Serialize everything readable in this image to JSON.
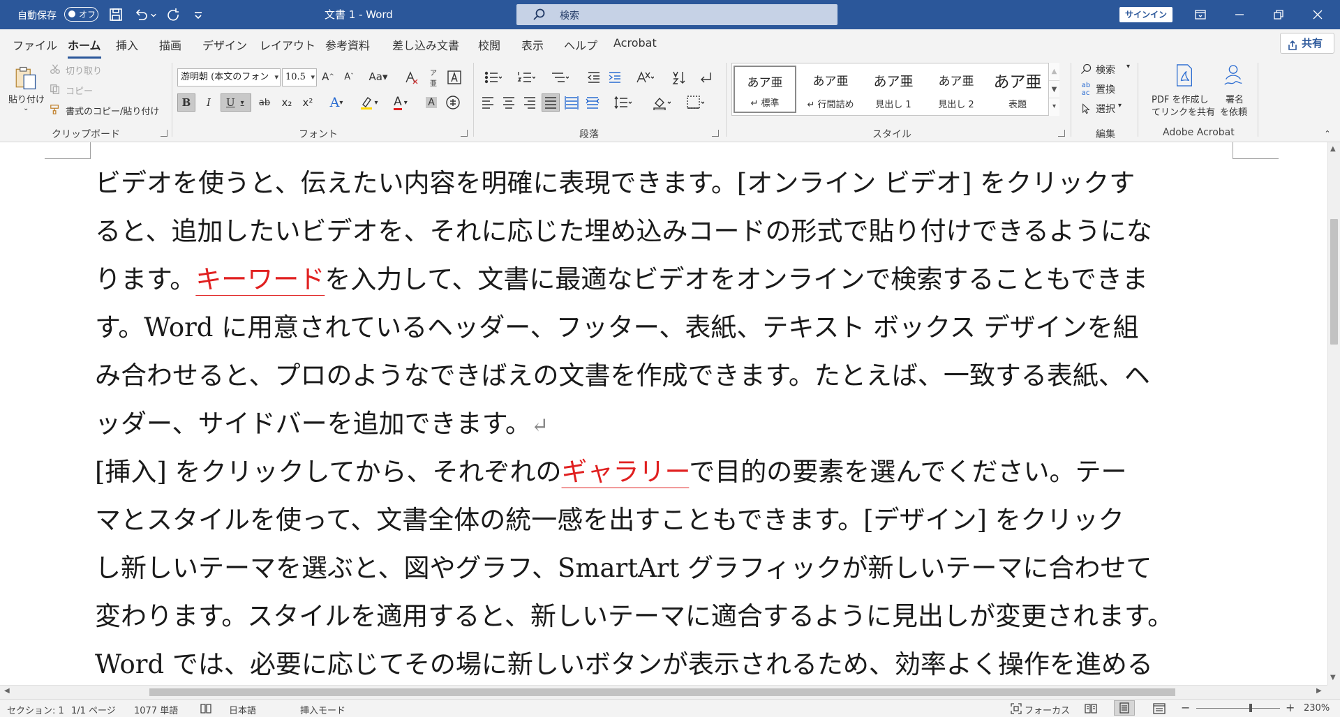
{
  "titlebar": {
    "autosave_label": "自動保存",
    "autosave_state": "オフ",
    "doc_title": "文書 1  -  Word",
    "search_placeholder": "検索",
    "signin_label": "サインイン"
  },
  "tabs": [
    "ファイル",
    "ホーム",
    "挿入",
    "描画",
    "デザイン",
    "レイアウト",
    "参考資料",
    "差し込み文書",
    "校閲",
    "表示",
    "ヘルプ",
    "Acrobat"
  ],
  "active_tab": "ホーム",
  "share_label": "共有",
  "ribbon": {
    "clipboard": {
      "group_label": "クリップボード",
      "paste_label": "貼り付け",
      "cut_label": "切り取り",
      "copy_label": "コピー",
      "format_painter_label": "書式のコピー/貼り付け"
    },
    "font": {
      "group_label": "フォント",
      "font_name": "游明朝 (本文のフォン",
      "font_size": "10.5",
      "grow_label": "A^",
      "shrink_label": "Aˇ",
      "case_label": "Aa",
      "bold": "B",
      "italic": "I",
      "underline": "U",
      "strike": "ab",
      "subscript": "x₂",
      "superscript": "x²"
    },
    "paragraph": {
      "group_label": "段落"
    },
    "styles": {
      "group_label": "スタイル",
      "items": [
        {
          "sample": "あア亜",
          "name": "↵ 標準"
        },
        {
          "sample": "あア亜",
          "name": "↵ 行間詰め"
        },
        {
          "sample": "あア亜",
          "name": "見出し 1"
        },
        {
          "sample": "あア亜",
          "name": "見出し 2"
        },
        {
          "sample": "あア亜",
          "name": "表題"
        }
      ]
    },
    "editing": {
      "group_label": "編集",
      "find_label": "検索",
      "replace_label": "置換",
      "select_label": "選択"
    },
    "acrobat": {
      "group_label": "Adobe Acrobat",
      "pdf_line1": "PDF を作成し",
      "pdf_line2": "てリンクを共有",
      "sign_line1": "署名",
      "sign_line2": "を依頼"
    }
  },
  "document": {
    "para1": {
      "line1": "ビデオを使うと、伝えたい内容を明確に表現できます。[オンライン ビデオ] をクリックす",
      "line2": "ると、追加したいビデオを、それに応じた埋め込みコードの形式で貼り付けできるようにな",
      "line3_pre": "ります。",
      "line3_mark": "キーワード",
      "line3_post": "を入力して、文書に最適なビデオをオンラインで検索することもできま",
      "line4": "す。Word に用意されているヘッダー、フッター、表紙、テキスト ボックス デザインを組",
      "line5": "み合わせると、プロのようなできばえの文書を作成できます。たとえば、一致する表紙、ヘ",
      "line6": "ッダー、サイドバーを追加できます。",
      "pilcrow": "↵"
    },
    "para2": {
      "line1_pre": "[挿入] をクリックしてから、それぞれの",
      "line1_mark": "ギャラリー",
      "line1_post": "で目的の要素を選んでください。テー",
      "line2": "マとスタイルを使って、文書全体の統一感を出すこともできます。[デザイン] をクリック",
      "line3": "し新しいテーマを選ぶと、図やグラフ、SmartArt グラフィックが新しいテーマに合わせて",
      "line4": "変わります。スタイルを適用すると、新しいテーマに適合するように見出しが変更されます。",
      "line5": "Word では、必要に応じてその場に新しいボタンが表示されるため、効率よく操作を進める"
    }
  },
  "statusbar": {
    "section": "セクション: 1",
    "page": "1/1 ページ",
    "words": "1077 単語",
    "language": "日本語",
    "insert_mode": "挿入モード",
    "focus": "フォーカス",
    "zoom": "230%"
  },
  "colors": {
    "titlebar": "#2b579a",
    "highlight_mark": "#e02020"
  }
}
